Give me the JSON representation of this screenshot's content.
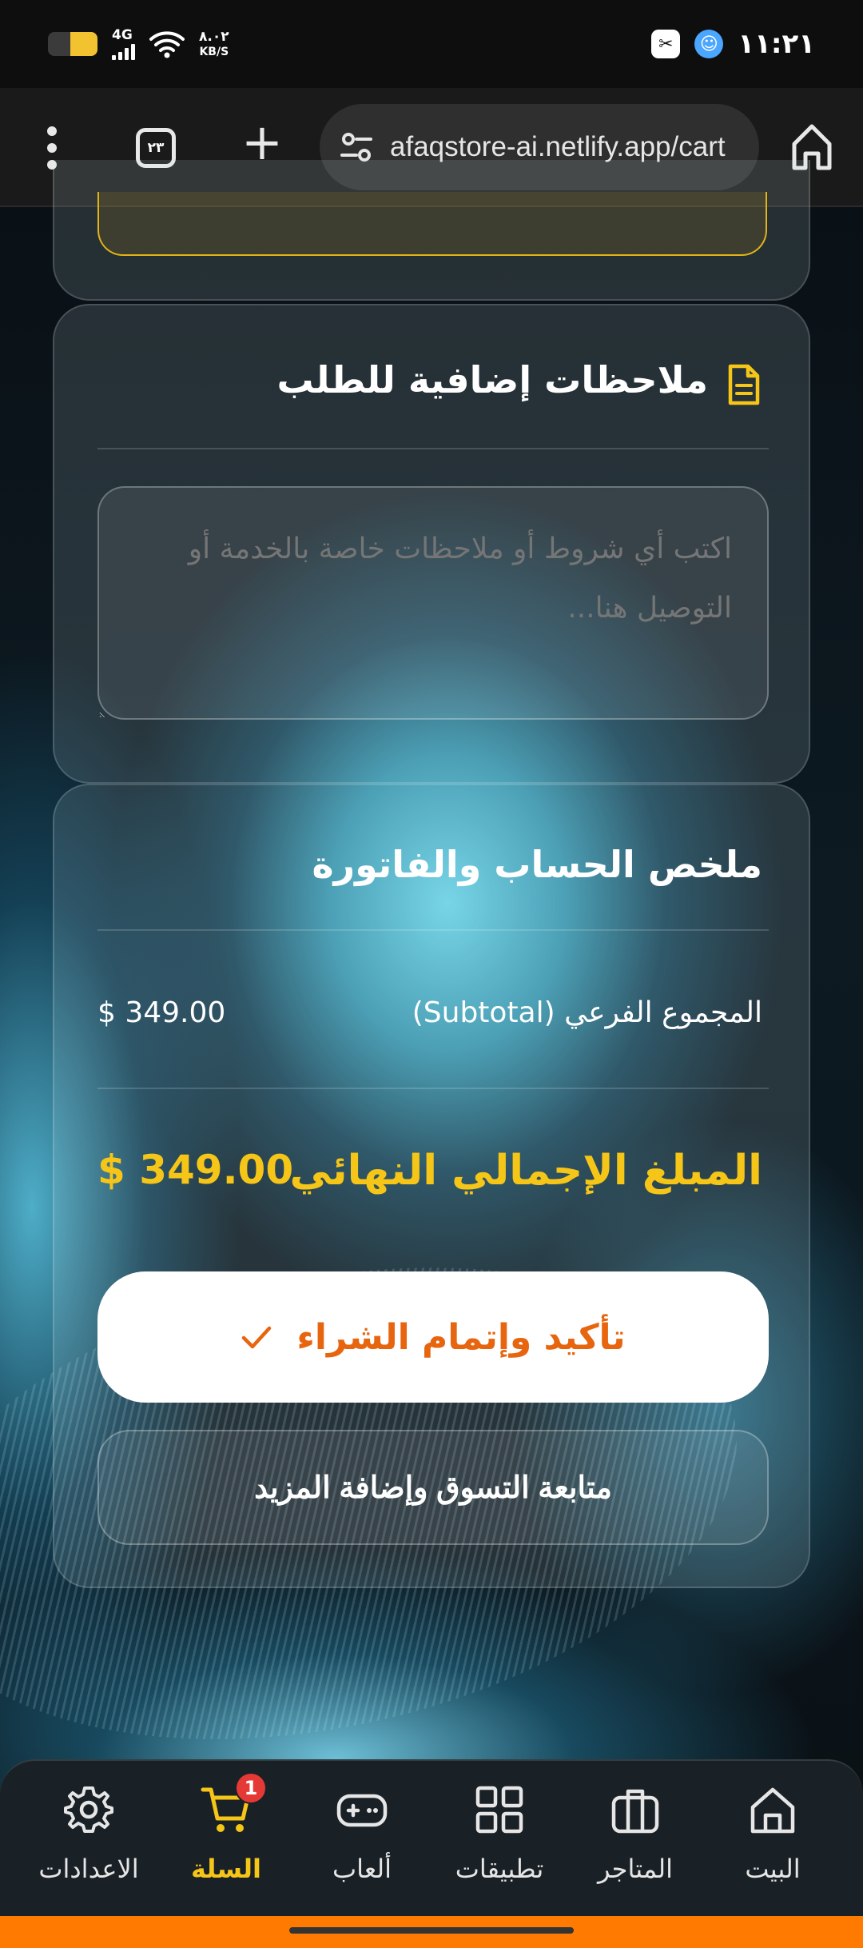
{
  "status_bar": {
    "network": "4G",
    "speed_value": "٨.٠٢",
    "speed_unit": "KB/S",
    "time": "١١:٢١"
  },
  "browser": {
    "url": "afaqstore-ai.netlify.app/cart",
    "tab_count": "٢٣"
  },
  "notes": {
    "title": "ملاحظات إضافية للطلب",
    "placeholder": "اكتب أي شروط أو ملاحظات خاصة بالخدمة أو التوصيل هنا..."
  },
  "summary": {
    "title": "ملخص الحساب والفاتورة",
    "subtotal_label": "المجموع الفرعي (Subtotal)",
    "subtotal_value": "$ 349.00",
    "total_label": "المبلغ الإجمالي النهائي",
    "total_value": "$ 349.00",
    "confirm_label": "تأكيد وإتمام الشراء",
    "continue_label": "متابعة التسوق وإضافة المزيد"
  },
  "nav": {
    "items": [
      {
        "label": "البيت",
        "icon": "home-icon"
      },
      {
        "label": "المتاجر",
        "icon": "briefcase-icon"
      },
      {
        "label": "تطبيقات",
        "icon": "apps-grid-icon"
      },
      {
        "label": "ألعاب",
        "icon": "gamepad-icon"
      },
      {
        "label": "السلة",
        "icon": "cart-icon",
        "badge": "1",
        "active": true
      },
      {
        "label": "الاعدادات",
        "icon": "settings-gear-icon"
      }
    ]
  },
  "colors": {
    "accent_yellow": "#f5c518",
    "confirm_text": "#e8650f",
    "badge_red": "#e53935",
    "bottom_strip": "#ff7a00"
  }
}
